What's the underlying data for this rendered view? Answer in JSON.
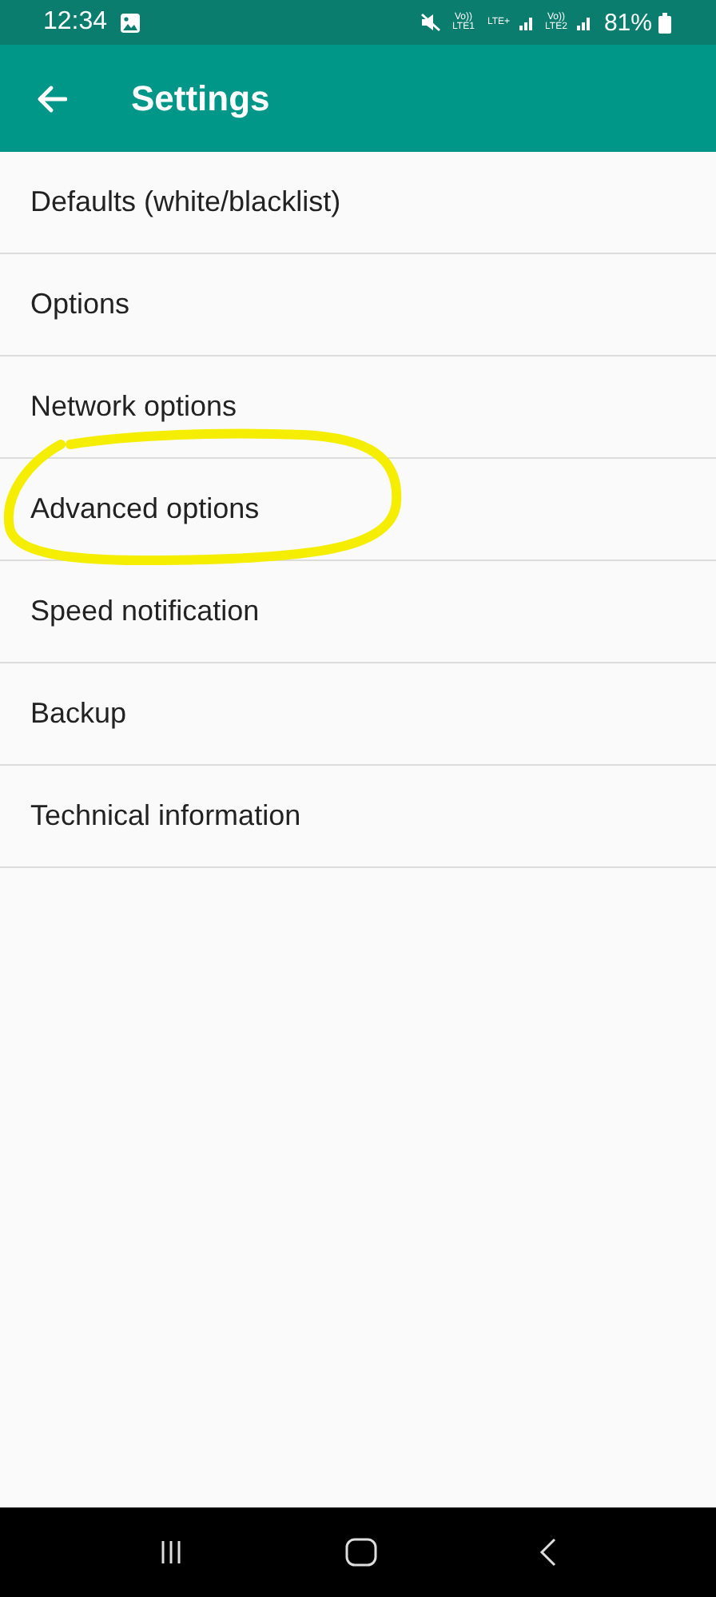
{
  "status_bar": {
    "time": "12:34",
    "network_labels": [
      "Vo)) LTE1",
      "LTE+",
      "Vo)) LTE2"
    ],
    "battery": "81%"
  },
  "app_bar": {
    "title": "Settings"
  },
  "items": [
    {
      "label": "Defaults (white/blacklist)",
      "circled": false
    },
    {
      "label": "Options",
      "circled": false
    },
    {
      "label": "Network options",
      "circled": false
    },
    {
      "label": "Advanced options",
      "circled": true
    },
    {
      "label": "Speed notification",
      "circled": false
    },
    {
      "label": "Backup",
      "circled": false
    },
    {
      "label": "Technical information",
      "circled": false
    }
  ]
}
